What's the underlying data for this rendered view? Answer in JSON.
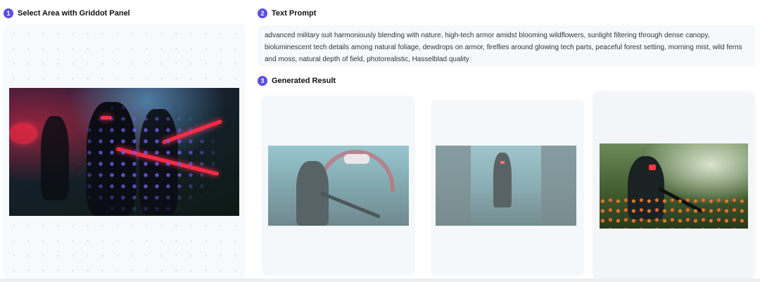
{
  "steps": [
    {
      "number": "1",
      "title": "Select Area with Griddot Panel"
    },
    {
      "number": "2",
      "title": "Text Prompt"
    },
    {
      "number": "3",
      "title": "Generated Result"
    }
  ],
  "prompt": {
    "text": "advanced military suit harmoniously blending with nature, high-tech armor amidst blooming wildflowers, sunlight filtering through dense canopy, bioluminescent tech details among natural foliage, dewdrops on armor, fireflies around glowing tech parts, peaceful forest setting, morning mist, wild ferns and moss, natural depth of field, photorealistic, Hasselblad quality"
  },
  "colors": {
    "accent": "#5b4ee0",
    "panel_bg": "#f7fafc",
    "glow": "#ff2a45"
  },
  "results": [
    {
      "state": "faded",
      "scene": "neon-city-street"
    },
    {
      "state": "faded",
      "scene": "rainy-city-street"
    },
    {
      "state": "selected",
      "scene": "forest-wildflowers"
    }
  ]
}
